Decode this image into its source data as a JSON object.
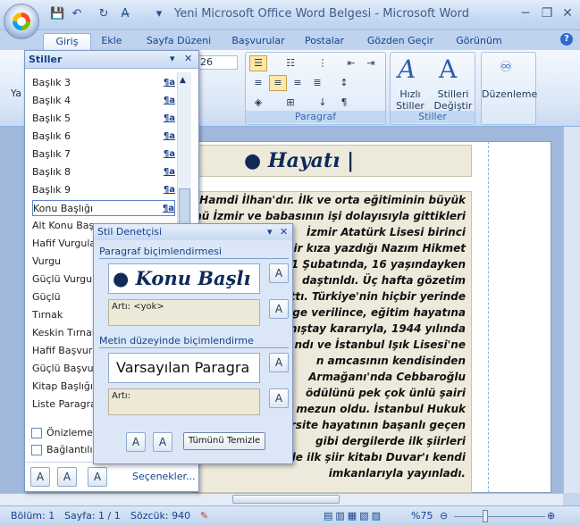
{
  "window": {
    "title": "Yeni Microsoft Office Word Belgesi - Microsoft Word",
    "minimize": "─",
    "restore": "❐",
    "close": "✕"
  },
  "qa": {
    "save": "💾",
    "undo": "↶",
    "redo": "↻",
    "format": "A̶",
    "more": "▾"
  },
  "tabs": [
    {
      "label": "Giriş",
      "active": true
    },
    {
      "label": "Ekle"
    },
    {
      "label": "Sayfa Düzeni"
    },
    {
      "label": "Başvurular"
    },
    {
      "label": "Postalar"
    },
    {
      "label": "Gözden Geçir"
    },
    {
      "label": "Görünüm"
    }
  ],
  "help": "?",
  "ribbon": {
    "paste_label": "Ya",
    "font_size": "26",
    "paragraph_label": "Paragraf",
    "quick_styles_label": "Hızlı\nStiller",
    "change_styles_label": "Stilleri\nDeğiştir",
    "styles_group_label": "Stiller",
    "editing_label": "Düzenleme"
  },
  "styles_pane": {
    "title": "Stiller",
    "items": [
      {
        "label": "Başlık 3",
        "mark": "¶a"
      },
      {
        "label": "Başlık 4",
        "mark": "¶a"
      },
      {
        "label": "Başlık 5",
        "mark": "¶a"
      },
      {
        "label": "Başlık 6",
        "mark": "¶a"
      },
      {
        "label": "Başlık 7",
        "mark": "¶a"
      },
      {
        "label": "Başlık 8",
        "mark": "¶a"
      },
      {
        "label": "Başlık 9",
        "mark": "¶a"
      },
      {
        "label": "Konu Başlığı",
        "mark": "¶a",
        "selected": true
      },
      {
        "label": "Alt Konu Baş",
        "mark": ""
      },
      {
        "label": "Hafif Vurgula",
        "mark": ""
      },
      {
        "label": "Vurgu",
        "mark": ""
      },
      {
        "label": "Güçlü Vurgula",
        "mark": ""
      },
      {
        "label": "Güçlü",
        "mark": ""
      },
      {
        "label": "Tırnak",
        "mark": ""
      },
      {
        "label": "Keskin Tırnak",
        "mark": ""
      },
      {
        "label": "Hafif Başvuru",
        "mark": ""
      },
      {
        "label": "Güçlü Başvuru",
        "mark": ""
      },
      {
        "label": "Kitap Başlığı",
        "mark": ""
      },
      {
        "label": "Liste Paragra",
        "mark": ""
      }
    ],
    "preview_label": "Önizleme G",
    "linked_label": "Bağlantılı St",
    "options_link": "Seçenekler..."
  },
  "inspector": {
    "title": "Stil Denetçisi",
    "paragraph_section": "Paragraf biçimlendirmesi",
    "paragraph_style": "Konu Başlı",
    "paragraph_plus": "Artı: <yok>",
    "text_section": "Metin düzeyinde biçimlendirme",
    "text_style": "Varsayılan Paragra",
    "text_plus": "Artı:",
    "clear_all": "Tümünü Temizle"
  },
  "document": {
    "heading": "Hayatı",
    "lines": [
      "tlı Hamdi İlhan'dır. İlk ve orta eğitiminin büyük",
      "nü İzmir ve babasının işi dolayısıyla gittikleri",
      "İzmir Atatürk Lisesi birinci",
      "bir kıza yazdığı Nazım Hikmet",
      "1 Şubatında, 16 yaşındayken",
      "daştınldı. Üç hafta gözetim",
      "attı. Türkiye'nin hiçbir yerinde",
      "elge verilince, eğitim hayatına",
      "anıştay kararıyla, 1944 yılında",
      "ndı ve İstanbul Işık Lisesi'ne",
      "n amcasının kendisinden",
      "Armağanı'nda Cebbaroğlu",
      "ödülünü pek çok ünlü şairi",
      "mezun oldu. İstanbul Hukuk",
      "rsite hayatının başanlı geçen",
      "gibi dergilerde ilk şiirleri",
      "de ilk şiir kitabı Duvar'ı kendi",
      "imkanlarıyla yayınladı."
    ]
  },
  "status": {
    "section": "Bölüm: 1",
    "page": "Sayfa: 1 / 1",
    "words": "Sözcük: 940",
    "zoom": "%75"
  }
}
